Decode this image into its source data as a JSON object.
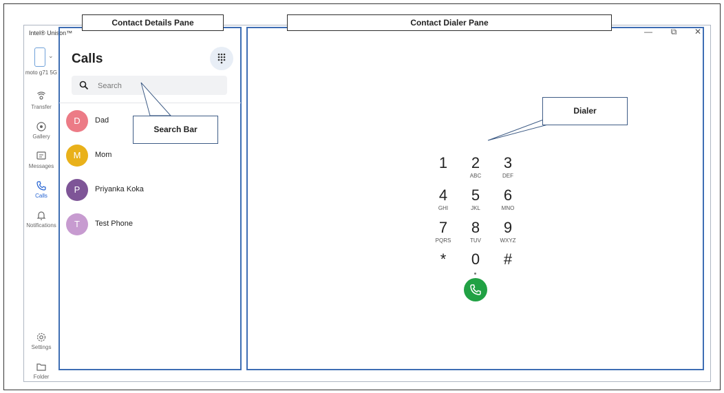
{
  "app": {
    "title": "Intel® Unison™",
    "device_name": "moto g71 5G",
    "window_controls": [
      "—",
      "⧉",
      "✕"
    ]
  },
  "nav": {
    "items": [
      {
        "label": "Transfer",
        "icon": "transfer-icon"
      },
      {
        "label": "Gallery",
        "icon": "gallery-icon"
      },
      {
        "label": "Messages",
        "icon": "messages-icon"
      },
      {
        "label": "Calls",
        "icon": "phone-icon",
        "active": true
      },
      {
        "label": "Notifications",
        "icon": "bell-icon"
      }
    ],
    "bottom": [
      {
        "label": "Settings",
        "icon": "gear-icon"
      },
      {
        "label": "Folder",
        "icon": "folder-icon"
      }
    ]
  },
  "calls": {
    "title": "Calls",
    "search_placeholder": "Search",
    "contacts": [
      {
        "initial": "D",
        "name": "Dad",
        "color": "#ec7b86"
      },
      {
        "initial": "M",
        "name": "Mom",
        "color": "#e9b11a"
      },
      {
        "initial": "P",
        "name": "Priyanka Koka",
        "color": "#7e5597"
      },
      {
        "initial": "T",
        "name": "Test Phone",
        "color": "#c79bd0"
      }
    ]
  },
  "dialer": {
    "keys": [
      {
        "digit": "1",
        "letters": ""
      },
      {
        "digit": "2",
        "letters": "ABC"
      },
      {
        "digit": "3",
        "letters": "DEF"
      },
      {
        "digit": "4",
        "letters": "GHI"
      },
      {
        "digit": "5",
        "letters": "JKL"
      },
      {
        "digit": "6",
        "letters": "MNO"
      },
      {
        "digit": "7",
        "letters": "PQRS"
      },
      {
        "digit": "8",
        "letters": "TUV"
      },
      {
        "digit": "9",
        "letters": "WXYZ"
      },
      {
        "digit": "*",
        "letters": ""
      },
      {
        "digit": "0",
        "letters": ""
      },
      {
        "digit": "#",
        "letters": ""
      }
    ],
    "call_color": "#21a144"
  },
  "annotations": {
    "contact_details_pane": "Contact Details Pane",
    "contact_dialer_pane": "Contact Dialer Pane",
    "search_bar": "Search Bar",
    "dialer": "Dialer"
  },
  "colors": {
    "pane_border": "#3d6db3",
    "accent": "#1f5fd1"
  }
}
